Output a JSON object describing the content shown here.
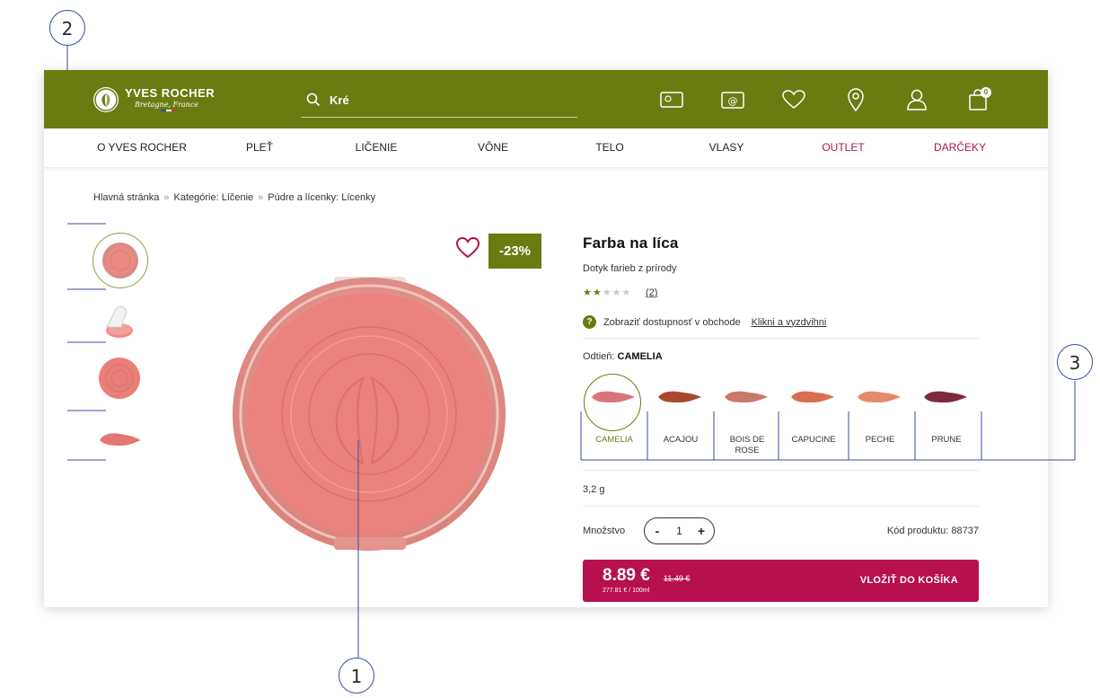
{
  "brand": {
    "name": "YVES ROCHER",
    "tagline": "Bretagne, France"
  },
  "header": {
    "search_value": "Kré",
    "cart_count": "0",
    "icons": [
      "gift-card-icon",
      "newsletter-icon",
      "heart-icon",
      "location-icon",
      "user-icon",
      "shopping-bag-icon"
    ]
  },
  "nav": {
    "items": [
      {
        "label": "O YVES ROCHER"
      },
      {
        "label": "PLEŤ"
      },
      {
        "label": "LIČENIE"
      },
      {
        "label": "VÔNE"
      },
      {
        "label": "TELO"
      },
      {
        "label": "VLASY"
      },
      {
        "label": "OUTLET"
      },
      {
        "label": "DARČEKY"
      }
    ]
  },
  "breadcrumb": {
    "items": [
      "Hlavná stránka",
      "Kategórie: Líčenie",
      "Púdre a lícenky: Lícenky"
    ],
    "separator": "»"
  },
  "product": {
    "discount": "-23%",
    "title": "Farba na líca",
    "subtitle": "Dotyk farieb z prírody",
    "rating": 2,
    "rating_max": 5,
    "reviews": "(2)",
    "availability_text": "Zobraziť dostupnosť v obchode",
    "availability_link": "Klikni a vyzdvihni",
    "shade_label": "Odtieň:",
    "shade_value": "CAMELIA",
    "shades": [
      {
        "name": "CAMELIA",
        "color": "#d9747a"
      },
      {
        "name": "ACAJOU",
        "color": "#a8492e"
      },
      {
        "name": "BOIS DE ROSE",
        "color": "#c9786a"
      },
      {
        "name": "CAPUCINE",
        "color": "#d96d4f"
      },
      {
        "name": "PECHE",
        "color": "#e38b6a"
      },
      {
        "name": "PRUNE",
        "color": "#7e2a3c"
      }
    ],
    "weight": "3,2 g",
    "quantity_label": "Množstvo",
    "quantity": "1",
    "code": "Kód produktu: 88737",
    "price": "8.89 €",
    "old_price": "11.49 €",
    "unit_price": "277.81 € / 100ml",
    "add_to_cart": "VLOŽIŤ DO KOŠÍKA"
  },
  "callouts": [
    "1",
    "2",
    "3"
  ],
  "colors": {
    "header_green": "#6b7b12",
    "accent_pink": "#b7104e",
    "annotation_blue": "#3a4da0",
    "blush_pink": "#e98a83"
  }
}
